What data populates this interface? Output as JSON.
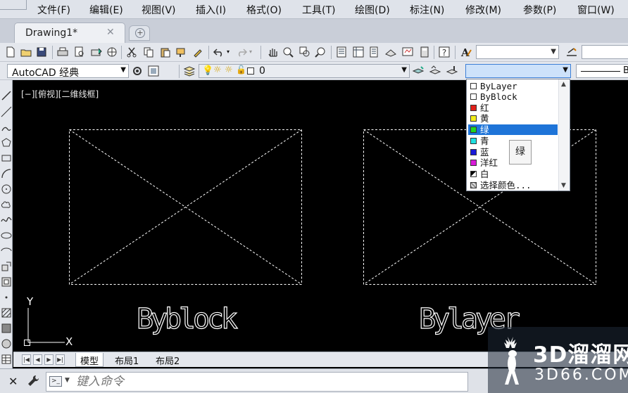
{
  "menu": [
    "文件(F)",
    "编辑(E)",
    "视图(V)",
    "插入(I)",
    "格式(O)",
    "工具(T)",
    "绘图(D)",
    "标注(N)",
    "修改(M)",
    "参数(P)",
    "窗口(W)"
  ],
  "tabs": {
    "document": "Drawing1*",
    "close": "✕"
  },
  "workspace": {
    "value": "AutoCAD 经典"
  },
  "layer": {
    "value": "0"
  },
  "linetype": {
    "value": "B"
  },
  "viewport": {
    "label": "[−][俯视][二维线框]"
  },
  "drawing": {
    "left_text": "Byblock",
    "right_text": "Bylayer",
    "ucs_y": "Y",
    "ucs_x": "X"
  },
  "color_dropdown": {
    "items": [
      {
        "label": "ByLayer",
        "swatch": "#ffffff"
      },
      {
        "label": "ByBlock",
        "swatch": "#ffffff"
      },
      {
        "label": "红",
        "swatch": "#e0201a"
      },
      {
        "label": "黄",
        "swatch": "#f2ee1b"
      },
      {
        "label": "绿",
        "swatch": "#1fd61f"
      },
      {
        "label": "青",
        "swatch": "#1fe0e0"
      },
      {
        "label": "蓝",
        "swatch": "#1a1ad8"
      },
      {
        "label": "洋红",
        "swatch": "#d81ad8"
      },
      {
        "label": "白",
        "swatch": "#000000"
      },
      {
        "label": "选择颜色...",
        "swatch": "#cccccc"
      }
    ],
    "selected": "绿",
    "tooltip": "绿"
  },
  "layout_tabs": [
    "模型",
    "布局1",
    "布局2"
  ],
  "command": {
    "placeholder": "键入命令"
  },
  "watermark": {
    "line1": "3D溜溜网",
    "line2": "3D66.COM"
  }
}
